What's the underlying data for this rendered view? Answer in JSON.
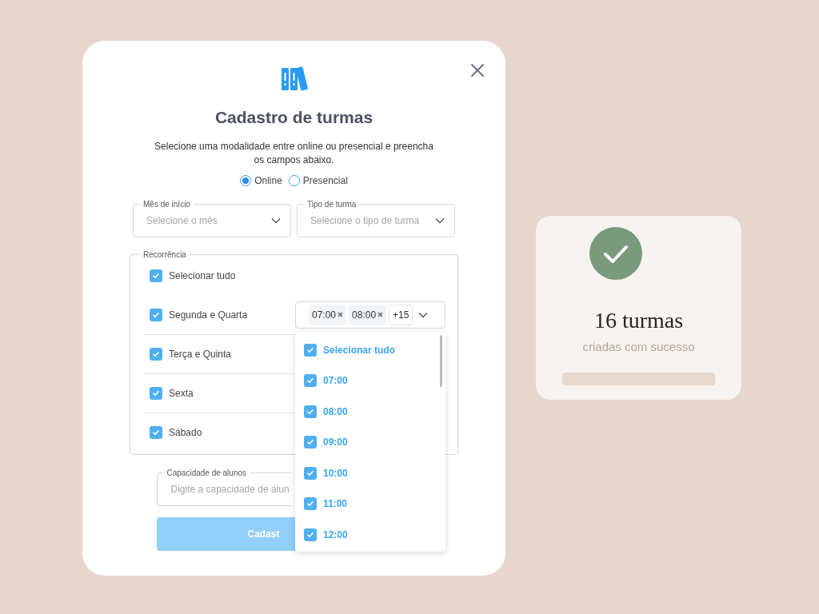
{
  "modal": {
    "title": "Cadastro de turmas",
    "description": "Selecione uma modalidade entre online ou presencial e preencha os campos abaixo.",
    "modalities": [
      {
        "label": "Online",
        "selected": true
      },
      {
        "label": "Presencial",
        "selected": false
      }
    ],
    "month": {
      "label": "Mês de início",
      "placeholder": "Selecione o mês"
    },
    "class_type": {
      "label": "Tipo de turma",
      "placeholder": "Selecione o tipo de turma"
    },
    "recurrence": {
      "legend": "Recorrência",
      "select_all": {
        "label": "Selecionar tudo",
        "checked": true
      },
      "days": [
        {
          "label": "Segunda e Quarta",
          "checked": true,
          "times": {
            "tags": [
              "07:00",
              "08:00"
            ],
            "more": "+15"
          }
        },
        {
          "label": "Terça e Quinta",
          "checked": true
        },
        {
          "label": "Sexta",
          "checked": true
        },
        {
          "label": "Sábado",
          "checked": true
        }
      ]
    },
    "capacity": {
      "label": "Capacidade de alunos",
      "placeholder": "Digite a capacidade de alun"
    },
    "submit": "Cadast",
    "dropdown": {
      "select_all": {
        "label": "Selecionar tudo",
        "checked": true
      },
      "options": [
        {
          "label": "07:00",
          "checked": true
        },
        {
          "label": "08:00",
          "checked": true
        },
        {
          "label": "09:00",
          "checked": true
        },
        {
          "label": "10:00",
          "checked": true
        },
        {
          "label": "11:00",
          "checked": true
        },
        {
          "label": "12:00",
          "checked": true
        }
      ]
    }
  },
  "success": {
    "count": "16 turmas",
    "message": "criadas com sucesso"
  }
}
